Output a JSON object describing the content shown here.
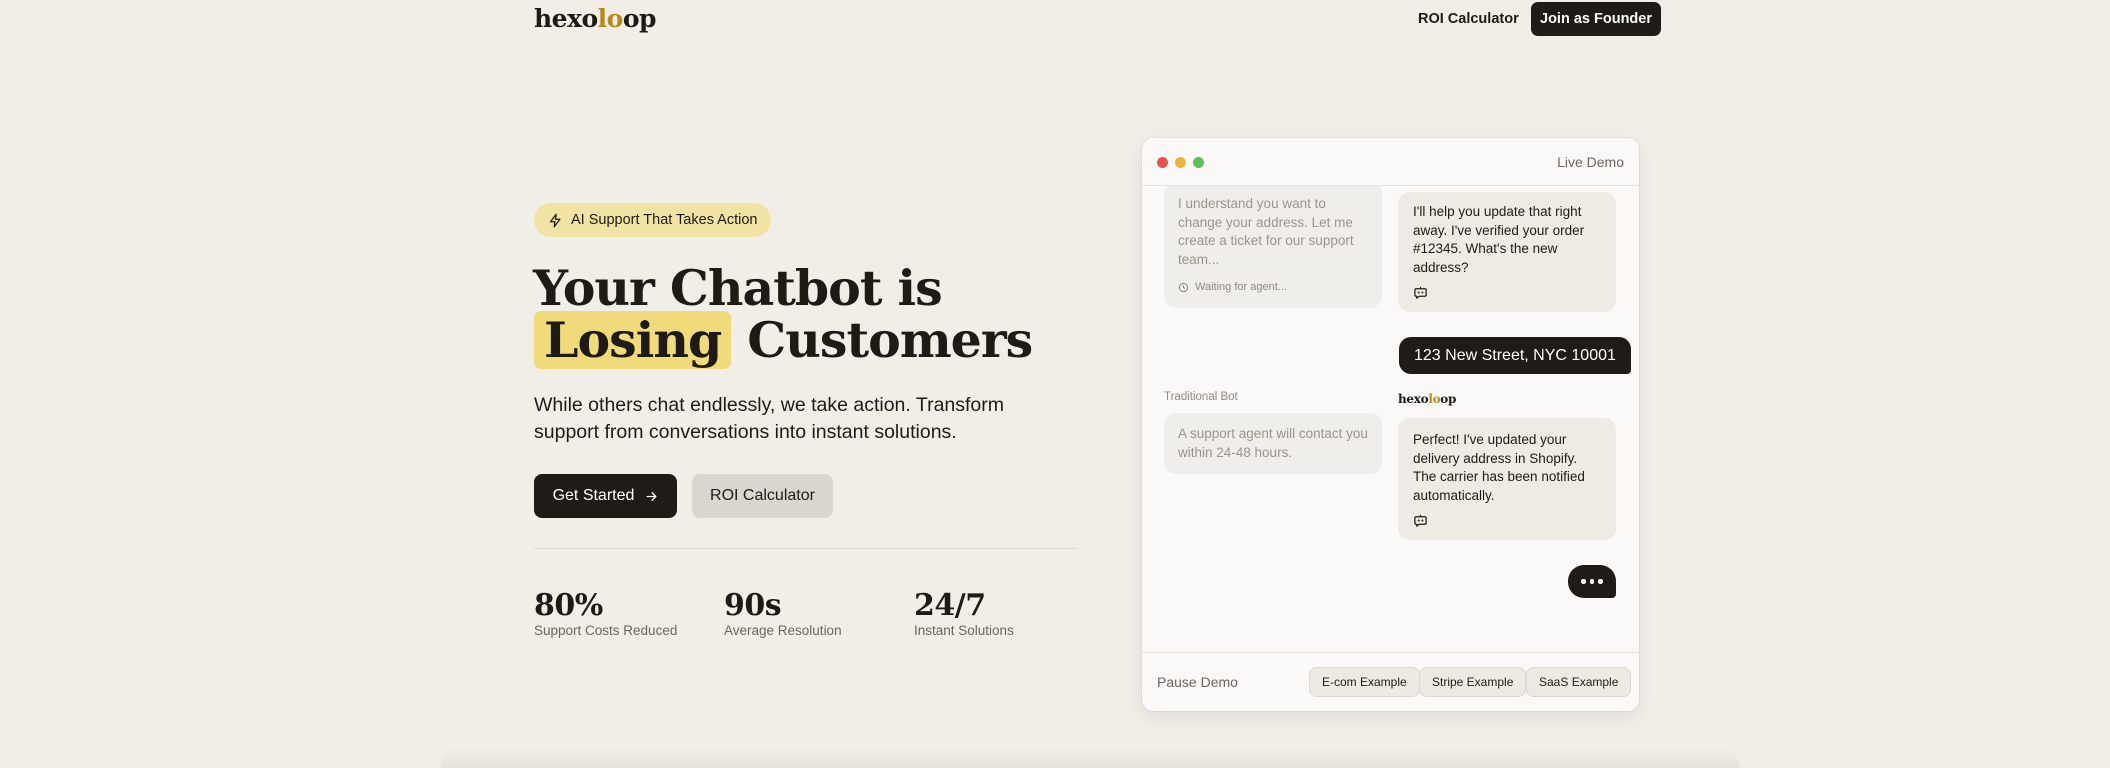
{
  "nav": {
    "logo_prefix": "hexo",
    "logo_oo": "lo",
    "logo_suffix": "op",
    "roi_link": "ROI Calculator",
    "cta": "Join as Founder"
  },
  "hero": {
    "badge_icon": "lightning-icon",
    "badge": "AI Support That Takes Action",
    "headline_line1": "Your Chatbot is",
    "headline_highlight": "Losing",
    "headline_rest": "Customers",
    "subtext": "While others chat endlessly, we take action. Transform support from conversations into instant solutions.",
    "primary_button": "Get Started",
    "primary_icon": "arrow-right-icon",
    "secondary_button": "ROI Calculator",
    "highlight_color": "#f1da7a"
  },
  "stats": [
    {
      "value": "80%",
      "label": "Support Costs Reduced"
    },
    {
      "value": "90s",
      "label": "Average Resolution"
    },
    {
      "value": "24/7",
      "label": "Instant Solutions"
    }
  ],
  "demo": {
    "title": "Live Demo",
    "window_dots": [
      "#e5544c",
      "#e9b73c",
      "#5bbf5a"
    ],
    "traditional_msg1": "I understand you want to change your address. Let me create a ticket for our support team...",
    "waiting": "Waiting for agent...",
    "hexo_msg1": "I'll help you update that right away. I've verified your order #12345. What's the new address?",
    "user_msg": "123 New Street, NYC 10001",
    "traditional_label": "Traditional Bot",
    "hexo_label_prefix": "hexo",
    "hexo_label_oo": "lo",
    "hexo_label_suffix": "op",
    "traditional_msg2": "A support agent will contact you within 24-48 hours.",
    "hexo_msg2": "Perfect! I've updated your delivery address in Shopify. The carrier has been notified automatically.",
    "pause": "Pause Demo",
    "examples": [
      "E-com Example",
      "Stripe Example",
      "SaaS Example"
    ]
  }
}
